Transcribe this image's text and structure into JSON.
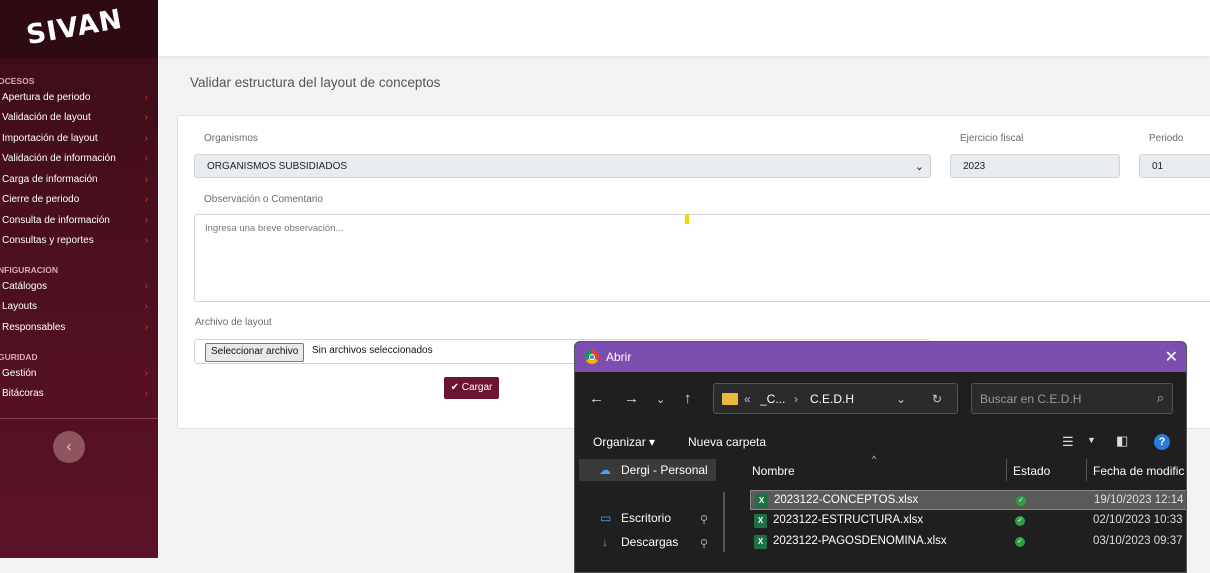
{
  "sidebar": {
    "logo": "SIVAN",
    "sections": [
      {
        "title": "OCESOS",
        "items": [
          "Apertura de periodo",
          "Validación de layout",
          "Importación de layout",
          "Validación de información",
          "Carga de información",
          "Cierre de periodo",
          "Consulta de información",
          "Consultas y reportes"
        ]
      },
      {
        "title": "NFIGURACION",
        "items": [
          "Catálogos",
          "Layouts",
          "Responsables"
        ]
      },
      {
        "title": "GURIDAD",
        "items": [
          "Gestión",
          "Bitácoras"
        ]
      }
    ],
    "chevron": "›",
    "collapse_glyph": "‹"
  },
  "page": {
    "title": "Validar estructura del layout de conceptos"
  },
  "form": {
    "organismos_label": "Organismos",
    "organismos_value": "ORGANISMOS SUBSIDIADOS",
    "ejercicio_label": "Ejercicio fiscal",
    "ejercicio_value": "2023",
    "periodo_label": "Periodo",
    "periodo_value": "01",
    "observacion_label": "Observación o Comentario",
    "observacion_placeholder": "Ingresa una breve observación...",
    "archivo_label": "Archivo de layout",
    "file_button": "Seleccionar archivo",
    "file_status": "Sin archivos seleccionados",
    "cargar": "✔ Cargar"
  },
  "dialog": {
    "title": "Abrir",
    "close": "✕",
    "address": {
      "prefix": "«",
      "part1": "_C...",
      "sep": "›",
      "part2": "C.E.D.H"
    },
    "search_placeholder": "Buscar en C.E.D.H",
    "organizar": "Organizar ▾",
    "nueva_carpeta": "Nueva carpeta",
    "nav_pane": [
      "Dergi - Personal",
      "Escritorio",
      "Descargas"
    ],
    "columns": [
      "Nombre",
      "Estado",
      "Fecha de modific"
    ],
    "files": [
      {
        "name": "2023122-CONCEPTOS.xlsx",
        "date": "19/10/2023 12:14"
      },
      {
        "name": "2023122-ESTRUCTURA.xlsx",
        "date": "02/10/2023 10:33"
      },
      {
        "name": "2023122-PAGOSDENOMINA.xlsx",
        "date": "03/10/2023 09:37"
      }
    ]
  }
}
